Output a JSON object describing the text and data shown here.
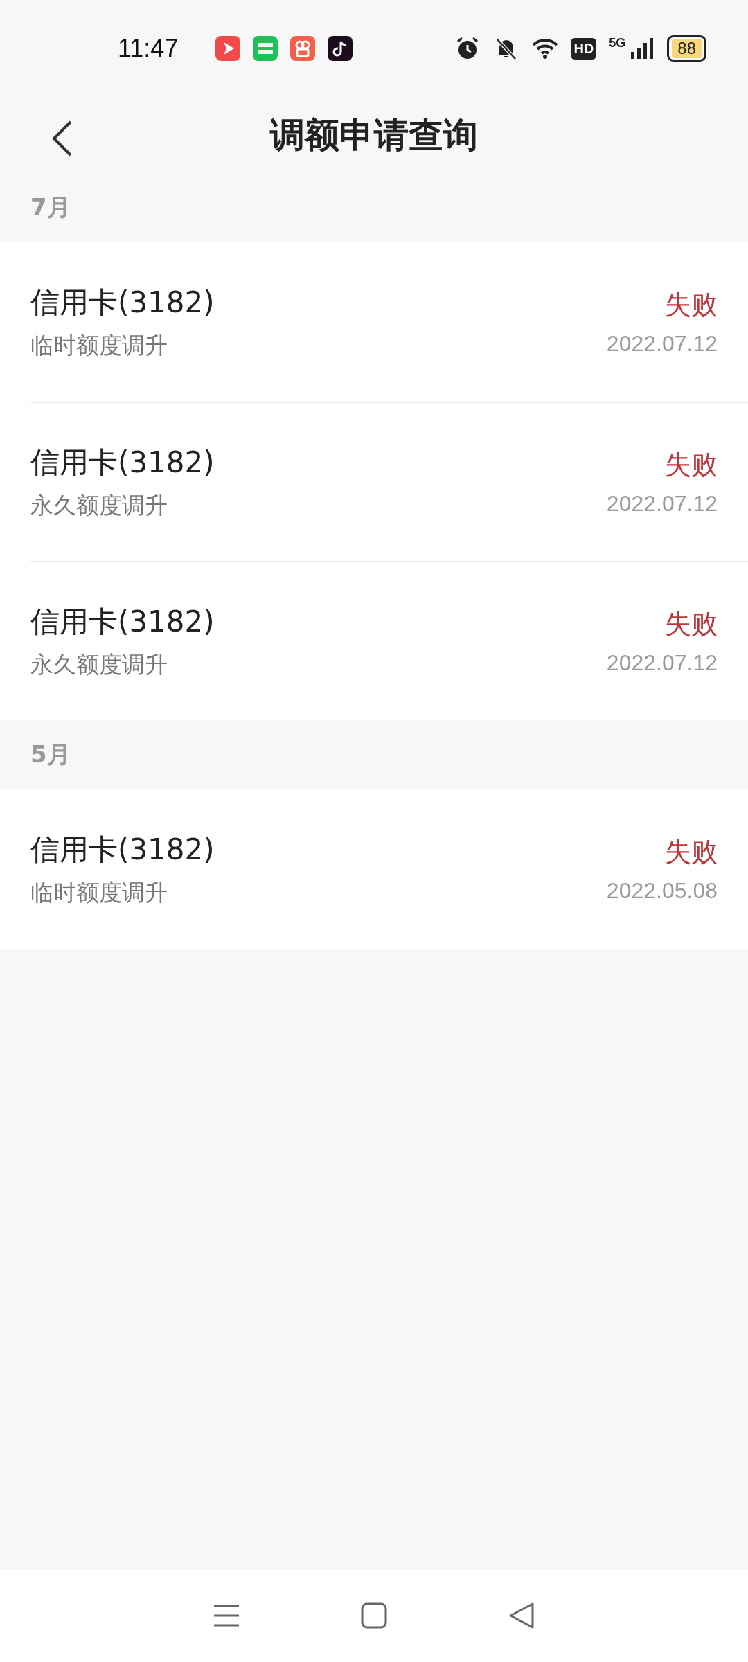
{
  "status_bar": {
    "time": "11:47",
    "hd": "HD",
    "network": "5G",
    "battery": "88"
  },
  "header": {
    "title": "调额申请查询"
  },
  "sections": [
    {
      "month": "7月",
      "items": [
        {
          "card": "信用卡(3182)",
          "type": "临时额度调升",
          "status": "失败",
          "date": "2022.07.12"
        },
        {
          "card": "信用卡(3182)",
          "type": "永久额度调升",
          "status": "失败",
          "date": "2022.07.12"
        },
        {
          "card": "信用卡(3182)",
          "type": "永久额度调升",
          "status": "失败",
          "date": "2022.07.12"
        }
      ]
    },
    {
      "month": "5月",
      "items": [
        {
          "card": "信用卡(3182)",
          "type": "临时额度调升",
          "status": "失败",
          "date": "2022.05.08"
        }
      ]
    }
  ]
}
